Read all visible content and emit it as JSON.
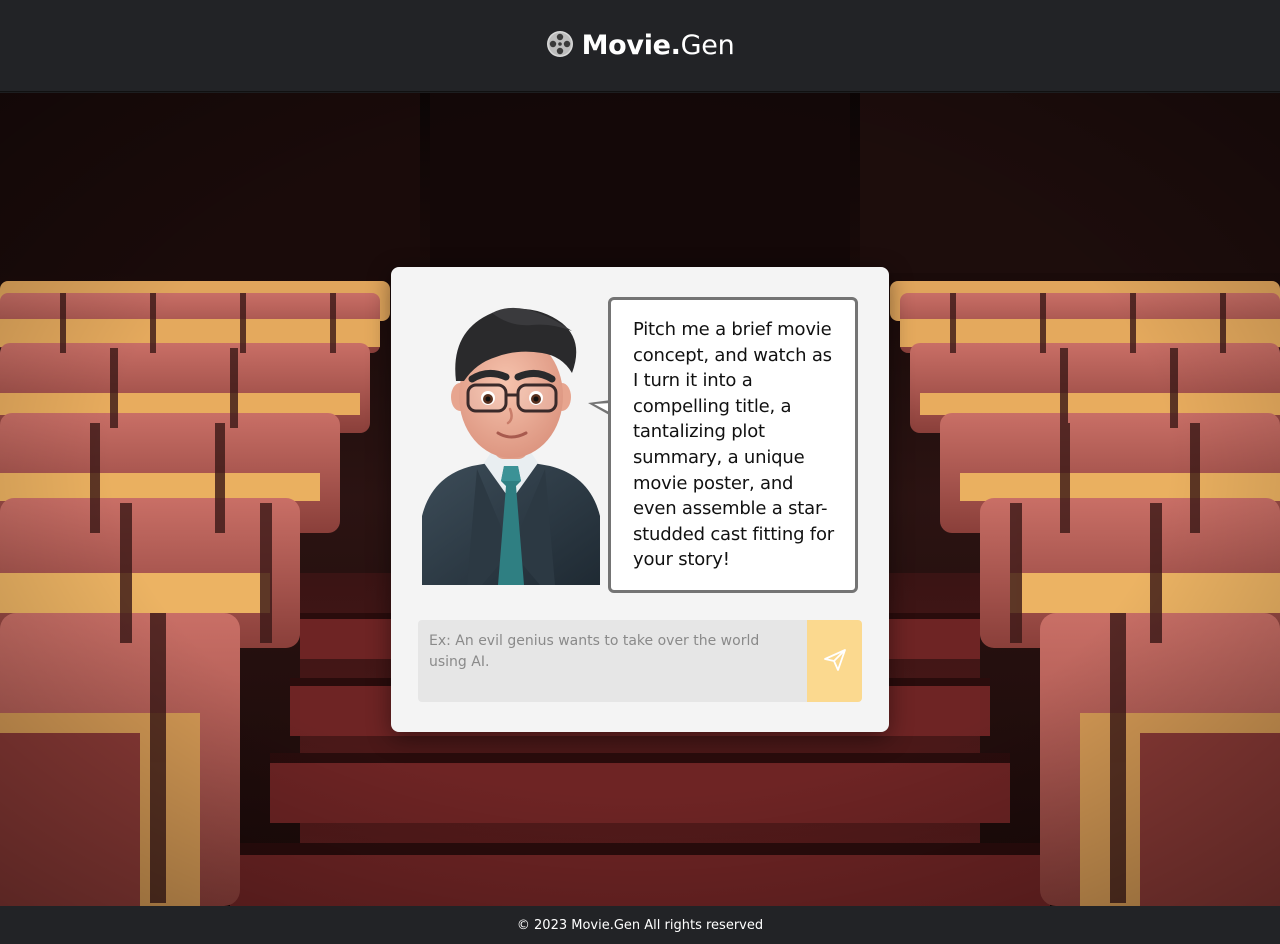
{
  "header": {
    "logo_icon": "film-reel-icon",
    "brand_bold": "Movie.",
    "brand_regular": "Gen"
  },
  "background": {
    "image": "empty-cinema-seats"
  },
  "card": {
    "avatar": "businessman-avatar-3d",
    "bubble_text": "Pitch me a brief movie concept, and watch as I turn it into a compelling title, a tantalizing plot summary, a unique movie poster, and even assemble a star-studded cast fitting for your story!",
    "input": {
      "value": "",
      "placeholder": "Ex: An evil genius wants to take over the world using AI."
    },
    "send_icon": "paper-plane-icon"
  },
  "colors": {
    "header_bg": "#222326",
    "card_bg": "#f4f4f4",
    "send_button_bg": "#fbd98f",
    "bubble_border": "#747474"
  },
  "footer": {
    "text": "© 2023 Movie.Gen All rights reserved"
  }
}
